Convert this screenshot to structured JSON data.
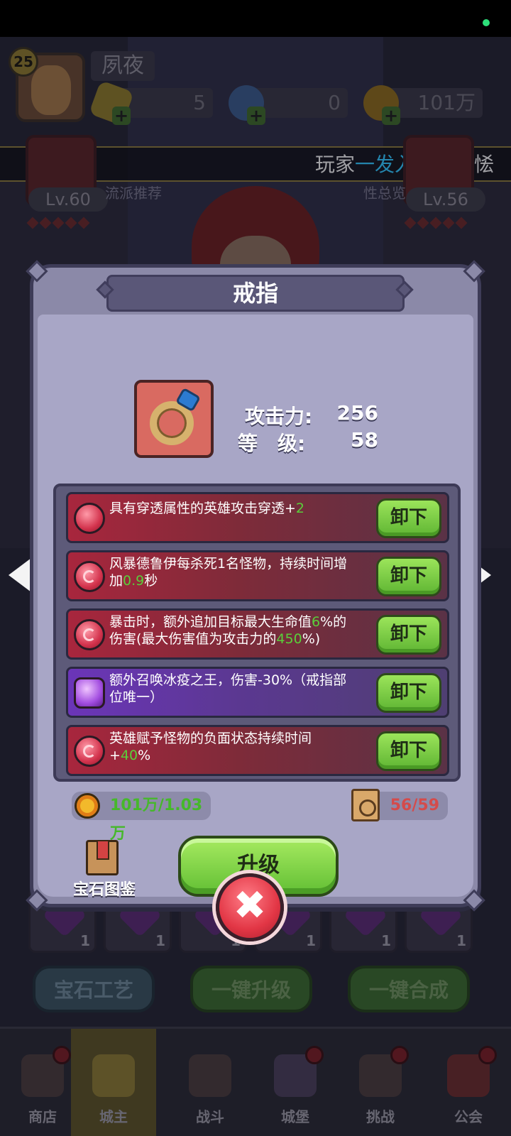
{
  "player": {
    "level": "25",
    "name": "夙夜",
    "resources": [
      {
        "icon": "gem-icon",
        "value": "5"
      },
      {
        "icon": "potion-icon",
        "value": "0"
      },
      {
        "icon": "gold-coin-icon",
        "value": "101万"
      }
    ]
  },
  "ticker": {
    "prefix": "玩家",
    "highlight": "一发入魂",
    "suffix": "气运恡"
  },
  "background": {
    "left_level": "Lv.60",
    "right_level": "Lv.56",
    "label_recommend": "流派推荐",
    "label_overview": "性总览",
    "slot_count": "1",
    "buttons": {
      "gem_craft": "宝石工艺",
      "one_key_upgrade": "一键升级",
      "one_key_merge": "一键合成"
    }
  },
  "modal": {
    "title": "戒指",
    "attack_label": "攻击力:",
    "attack_value": "256",
    "level_label": "等　级:",
    "level_value": "58",
    "gems": [
      {
        "type": "red",
        "text": "具有穿透属性的英雄攻击穿透+",
        "num": "2",
        "text2": "",
        "num2": "",
        "text3": "",
        "button": "卸下"
      },
      {
        "type": "red",
        "text": "风暴德鲁伊每杀死1名怪物，持续时间增加",
        "num": "0.9",
        "text2": "秒",
        "num2": "",
        "text3": "",
        "button": "卸下"
      },
      {
        "type": "red",
        "text": "暴击时，额外追加目标最大生命值",
        "num": "6",
        "text2": "%的伤害(最大伤害值为攻击力的",
        "num2": "450",
        "text3": "%)",
        "button": "卸下"
      },
      {
        "type": "purple",
        "text": "额外召唤冰疫之王，伤害-30%（戒指部位唯一）",
        "num": "",
        "text2": "",
        "num2": "",
        "text3": "",
        "button": "卸下"
      },
      {
        "type": "red",
        "text": "英雄赋予怪物的负面状态持续时间+",
        "num": "40",
        "text2": "%",
        "num2": "",
        "text3": "",
        "button": "卸下"
      }
    ],
    "gold_text": "101万/1.03万",
    "scroll_text": "56/59",
    "gem_book_label": "宝石图鉴",
    "upgrade_label": "升级",
    "close_symbol": "✖"
  },
  "nav": [
    {
      "label": "商店",
      "active": false
    },
    {
      "label": "城主",
      "active": true
    },
    {
      "label": "战斗",
      "active": false
    },
    {
      "label": "城堡",
      "active": false
    },
    {
      "label": "挑战",
      "active": false
    },
    {
      "label": "公会",
      "active": false
    }
  ],
  "colors": {
    "accent_green": "#59cf3a",
    "ticker_highlight": "#33c8ff",
    "cost_red": "#d44b4b"
  }
}
